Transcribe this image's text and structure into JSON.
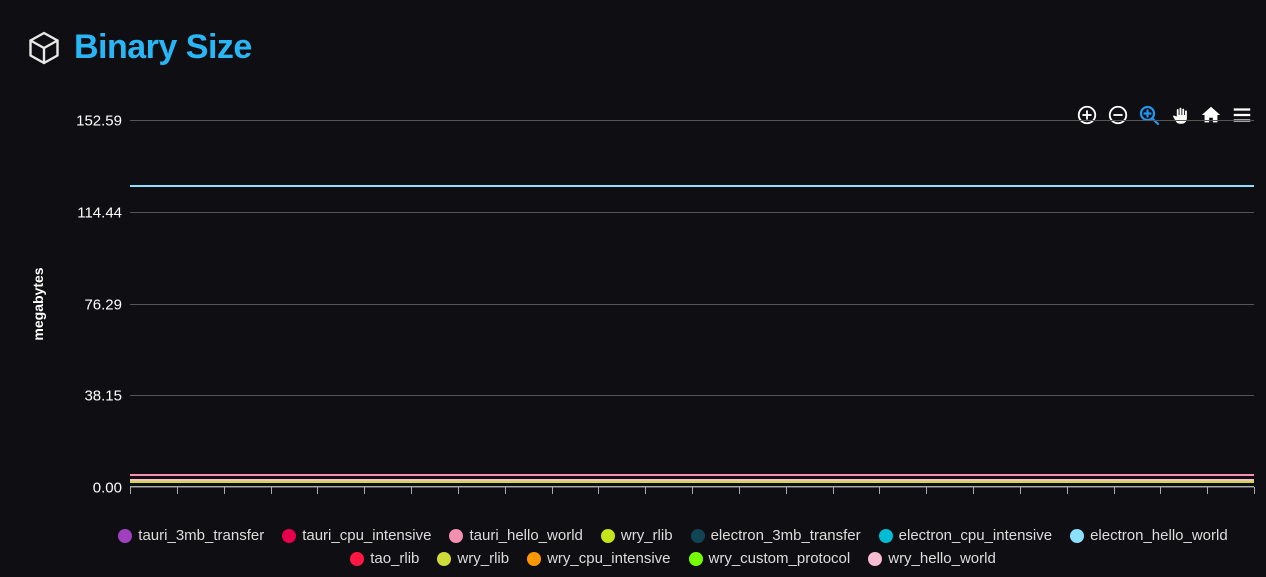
{
  "header": {
    "title": "Binary Size"
  },
  "toolbar": {
    "zoom_in": "zoom-in",
    "zoom_out": "zoom-out",
    "zoom_select": "zoom-select",
    "pan": "pan",
    "home": "home",
    "menu": "menu",
    "active": "zoom-select"
  },
  "chart_data": {
    "type": "line",
    "title": "Binary Size",
    "ylabel": "megabytes",
    "xlabel": "",
    "ylim": [
      0,
      152.59
    ],
    "y_ticks": [
      0.0,
      38.15,
      76.29,
      114.44,
      152.59
    ],
    "x_tick_count": 24,
    "series": [
      {
        "name": "tauri_3mb_transfer",
        "color": "#a040c0",
        "value": 5.0
      },
      {
        "name": "tauri_cpu_intensive",
        "color": "#e6004c",
        "value": 5.0
      },
      {
        "name": "tauri_hello_world",
        "color": "#f48fb1",
        "value": 5.0
      },
      {
        "name": "wry_rlib",
        "color": "#c6e619",
        "value": 2.0
      },
      {
        "name": "electron_3mb_transfer",
        "color": "#114455",
        "value": 125.0
      },
      {
        "name": "electron_cpu_intensive",
        "color": "#00bcd4",
        "value": 125.0
      },
      {
        "name": "electron_hello_world",
        "color": "#8be0ff",
        "value": 125.0
      },
      {
        "name": "tao_rlib",
        "color": "#ff1744",
        "value": 2.0
      },
      {
        "name": "wry_rlib",
        "color": "#cddc39",
        "value": 2.0
      },
      {
        "name": "wry_cpu_intensive",
        "color": "#ff9800",
        "value": 3.0
      },
      {
        "name": "wry_custom_protocol",
        "color": "#76ff03",
        "value": 3.0
      },
      {
        "name": "wry_hello_world",
        "color": "#f8bbd0",
        "value": 3.0
      }
    ]
  }
}
